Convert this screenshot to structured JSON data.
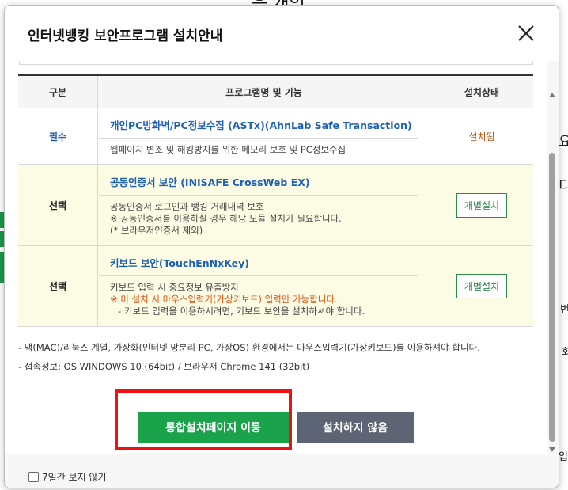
{
  "modal": {
    "title": "인터넷뱅킹 보안프로그램 설치안내"
  },
  "table": {
    "headers": [
      "구분",
      "프로그램명 및 기능",
      "설치상태"
    ],
    "rows": [
      {
        "category": "필수",
        "name": "개인PC방화벽/PC정보수집 (ASTx)(AhnLab Safe Transaction)",
        "desc": [
          "웹페이지 변조 및 해킹방지를 위한 메모리 보호 및 PC정보수집"
        ],
        "status": "설치됨"
      },
      {
        "category": "선택",
        "name": "공동인증서 보안 (INISAFE CrossWeb EX)",
        "desc": [
          "공동인증서 로그인과 뱅킹 거래내역 보호",
          "※ 공동인증서를 이용하실 경우 해당 모듈 설치가 필요합니다.",
          "(* 브라우저인증서 제외)"
        ],
        "status": "개별설치"
      },
      {
        "category": "선택",
        "name": "키보드 보안(TouchEnNxKey)",
        "desc": [
          "키보드 입력 시 중요정보 유출방지",
          "※ 미 설치 시 마우스입력기(가상키보드) 입력만 가능합니다.",
          "- 키보드 입력을 이용하시려면, 키보드 보안을 설치하셔야 합니다."
        ],
        "status": "개별설치"
      }
    ]
  },
  "notes": [
    "- 맥(MAC)/리눅스 계열, 가상화(인터넷 망분리 PC, 가상OS) 환경에서는 마우스입력기(가상키보드)를 이용하셔야 합니다.",
    "- 접속정보: OS WINDOWS 10 (64bit) / 브라우저 Chrome 141 (32bit)"
  ],
  "buttons": {
    "primary": "통합설치페이지 이동",
    "secondary": "설치하지 않음"
  },
  "footer": {
    "checkbox_label": "7일간 보지 않기"
  },
  "background": {
    "frag_top": "은 개인",
    "frag_r1": "요",
    "frag_r2": "디",
    "frag_r3": "번",
    "frag_r4": "회",
    "frag_r5": "입"
  },
  "colors": {
    "accent_green": "#1aa34a",
    "secondary_gray": "#5d6473",
    "link_blue": "#1d5fb3",
    "warning_orange": "#d6540f",
    "highlight_red": "#ee1111",
    "row_yellow": "#fcfbe3"
  },
  "icons": [
    "close-icon",
    "checkbox-icon"
  ]
}
